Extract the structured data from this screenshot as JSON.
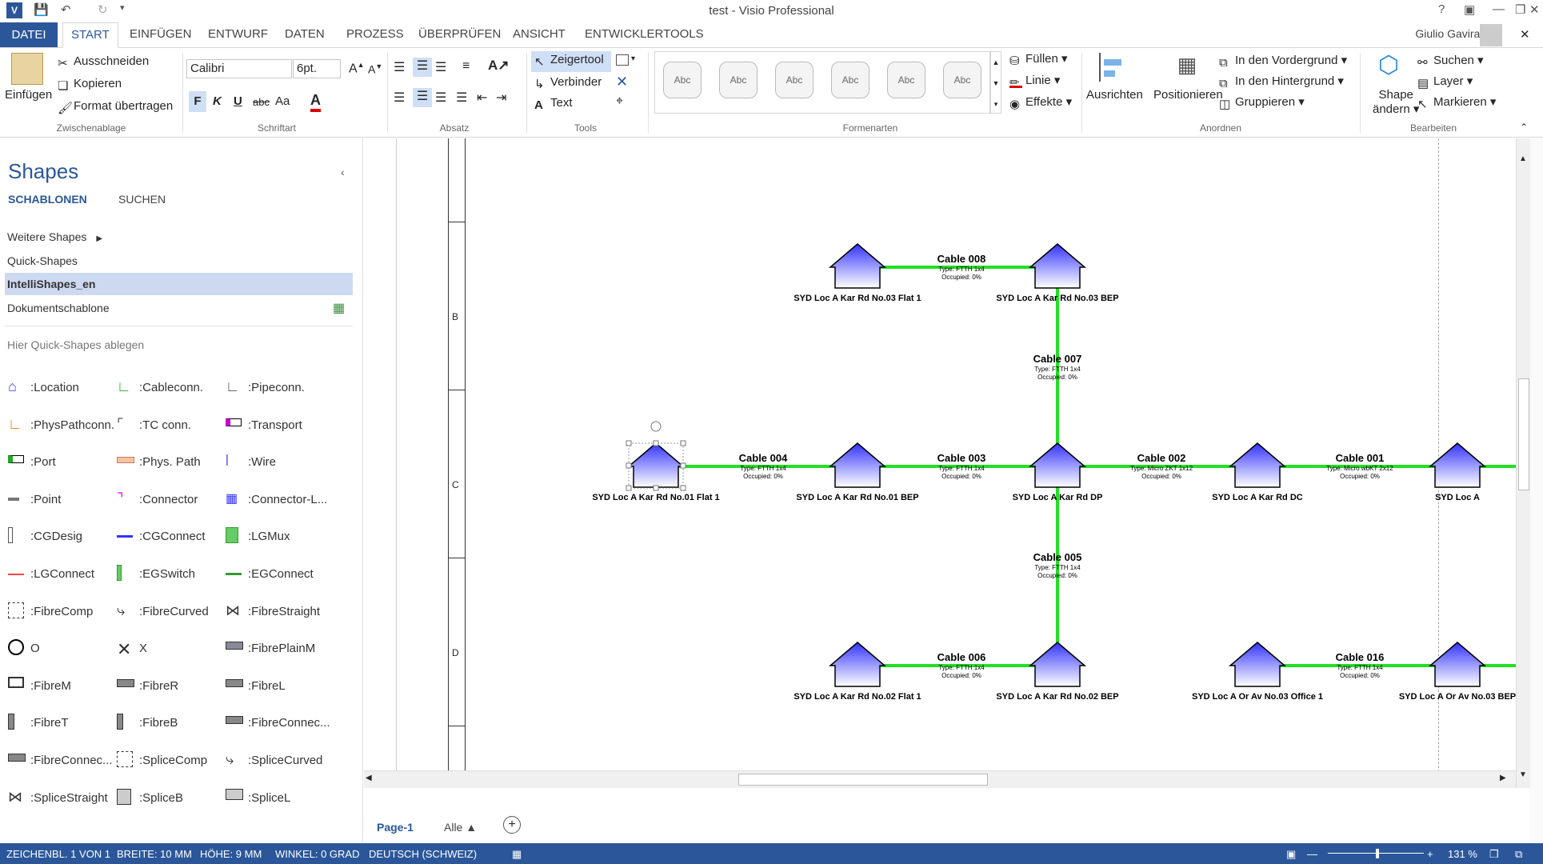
{
  "window": {
    "title": "test - Visio Professional"
  },
  "tabs": {
    "file": "DATEI",
    "items": [
      "START",
      "EINFÜGEN",
      "ENTWURF",
      "DATEN",
      "PROZESS",
      "ÜBERPRÜFEN",
      "ANSICHT",
      "ENTWICKLERTOOLS"
    ],
    "user": "Giulio Gaviraghi"
  },
  "ribbon": {
    "clipboard": {
      "paste": "Einfügen",
      "cut": "Ausschneiden",
      "copy": "Kopieren",
      "format": "Format übertragen",
      "label": "Zwischenablage"
    },
    "font": {
      "name": "Calibri",
      "size": "6pt.",
      "bold": "F",
      "italic": "K",
      "underline": "U",
      "strike": "abc",
      "case": "Aa",
      "label": "Schriftart"
    },
    "paragraph": {
      "label": "Absatz"
    },
    "tools": {
      "pointer": "Zeigertool",
      "connector": "Verbinder",
      "text": "Text",
      "label": "Tools"
    },
    "styles": {
      "abc": "Abc",
      "label": "Formenarten"
    },
    "fill": {
      "fill": "Füllen",
      "line": "Linie",
      "effects": "Effekte"
    },
    "arrange": {
      "align": "Ausrichten",
      "position": "Positionieren",
      "front": "In den Vordergrund",
      "back": "In den Hintergrund",
      "group": "Gruppieren",
      "label": "Anordnen"
    },
    "editing": {
      "change_shape_1": "Shape",
      "change_shape_2": "ändern",
      "find": "Suchen",
      "layer": "Layer",
      "select": "Markieren",
      "label": "Bearbeiten"
    }
  },
  "pane": {
    "title": "Shapes",
    "tab_stencils": "SCHABLONEN",
    "tab_search": "SUCHEN",
    "more_shapes": "Weitere Shapes",
    "quick_shapes": "Quick-Shapes",
    "intelli": "IntelliShapes_en",
    "doc_stencil": "Dokumentschablone",
    "drop_hint": "Hier Quick-Shapes ablegen",
    "shapes": [
      [
        ":Location",
        ":Cableconn.",
        ":Pipeconn."
      ],
      [
        ":PhysPathconn.",
        ":TC conn.",
        ":Transport"
      ],
      [
        ":Port",
        ":Phys. Path",
        ":Wire"
      ],
      [
        ":Point",
        ":Connector",
        ":Connector-L..."
      ],
      [
        ":CGDesig",
        ":CGConnect",
        ":LGMux"
      ],
      [
        ":LGConnect",
        ":EGSwitch",
        ":EGConnect"
      ],
      [
        ":FibreComp",
        ":FibreCurved",
        ":FibreStraight"
      ],
      [
        "O",
        "X",
        ":FibrePlainM"
      ],
      [
        ":FibreM",
        ":FibreR",
        ":FibreL"
      ],
      [
        ":FibreT",
        ":FibreB",
        ":FibreConnec..."
      ],
      [
        ":FibreConnec...",
        ":SpliceComp",
        ":SpliceCurved"
      ],
      [
        ":SpliceStraight",
        ":SpliceB",
        ":SpliceL"
      ]
    ]
  },
  "diagram": {
    "ruler_labels": [
      "B",
      "C",
      "D"
    ],
    "nodes": [
      {
        "id": "n1",
        "label": "SYD Loc A Kar Rd No.03 Flat 1"
      },
      {
        "id": "n2",
        "label": "SYD Loc A Kar Rd No.03 BEP"
      },
      {
        "id": "n3",
        "label": "SYD Loc A Kar Rd No.01 Flat 1"
      },
      {
        "id": "n4",
        "label": "SYD Loc A Kar Rd No.01 BEP"
      },
      {
        "id": "n5",
        "label": "SYD Loc A Kar Rd DP"
      },
      {
        "id": "n6",
        "label": "SYD Loc A Kar Rd DC"
      },
      {
        "id": "n7",
        "label": "SYD Loc A"
      },
      {
        "id": "n8",
        "label": "SYD Loc A Kar Rd No.02 Flat 1"
      },
      {
        "id": "n9",
        "label": "SYD Loc A Kar Rd No.02 BEP"
      },
      {
        "id": "n10",
        "label": "SYD Loc A Or Av No.03 Office 1"
      },
      {
        "id": "n11",
        "label": "SYD Loc A Or Av No.03 BEP"
      }
    ],
    "cables": [
      {
        "name": "Cable 008",
        "type": "Type: FTTH 1x4",
        "occ": "Occupied: 0%"
      },
      {
        "name": "Cable 007",
        "type": "Type: FTTH 1x4",
        "occ": "Occupied: 0%"
      },
      {
        "name": "Cable 004",
        "type": "Type: FTTH 1x4",
        "occ": "Occupied: 0%"
      },
      {
        "name": "Cable 003",
        "type": "Type: FTTH 1x4",
        "occ": "Occupied: 0%"
      },
      {
        "name": "Cable 002",
        "type": "Type: Micro ZKT 1x12",
        "occ": "Occupied: 0%"
      },
      {
        "name": "Cable 001",
        "type": "Type: Micro wbKT 2x12",
        "occ": "Occupied: 0%"
      },
      {
        "name": "Cable 005",
        "type": "Type: FTTH 1x4",
        "occ": "Occupied: 0%"
      },
      {
        "name": "Cable 006",
        "type": "Type: FTTH 1x4",
        "occ": "Occupied: 0%"
      },
      {
        "name": "Cable 016",
        "type": "Type: FTTH 1x4",
        "occ": "Occupied: 0%"
      }
    ],
    "colors": {
      "cable": "#22e022",
      "node_top": "#3333ff",
      "node_bottom": "#ffffff"
    }
  },
  "pagetabs": {
    "page": "Page-1",
    "all": "Alle"
  },
  "status": {
    "sheet": "ZEICHENBL. 1 VON 1",
    "width": "BREITE: 10 MM",
    "height": "HÖHE: 9 MM",
    "angle": "WINKEL: 0 GRAD",
    "lang": "DEUTSCH (SCHWEIZ)",
    "zoom": "131 %"
  }
}
